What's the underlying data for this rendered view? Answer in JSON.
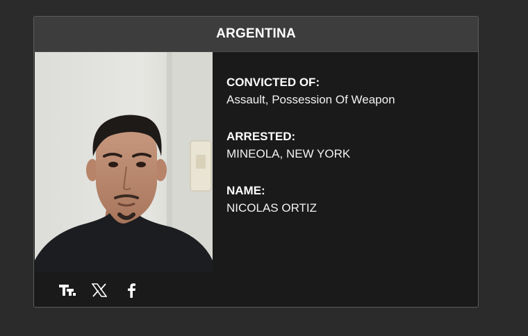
{
  "card": {
    "country": "ARGENTINA",
    "photo_icon": "mugshot-photo",
    "fields": [
      {
        "label": "CONVICTED OF:",
        "value": "Assault, Possession Of Weapon"
      },
      {
        "label": "ARRESTED:",
        "value": "MINEOLA, NEW YORK"
      },
      {
        "label": "NAME:",
        "value": "NICOLAS ORTIZ"
      }
    ],
    "share_icons": [
      "truth-social-icon",
      "x-icon",
      "facebook-icon"
    ]
  },
  "colors": {
    "page_background": "#2b2b2b",
    "card_background": "#1a1a1a",
    "header_background": "#3d3d3d",
    "border": "#5c5c5c",
    "text": "#ffffff"
  }
}
